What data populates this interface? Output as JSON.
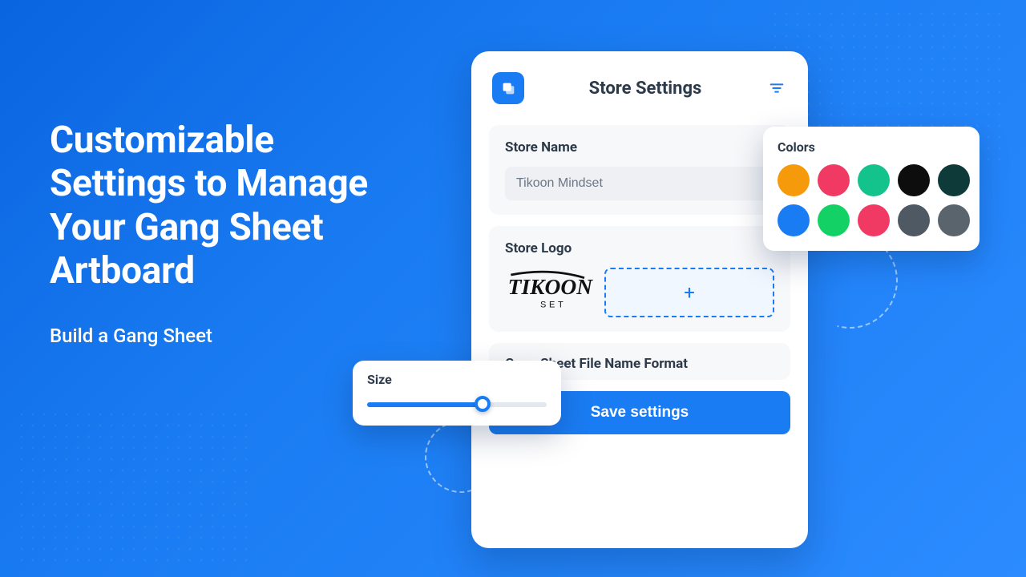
{
  "hero": {
    "headline": "Customizable Settings to Manage Your Gang Sheet Artboard",
    "subline": "Build a Gang Sheet"
  },
  "panel": {
    "title": "Store Settings",
    "store_name_label": "Store Name",
    "store_name_value": "Tikoon Mindset",
    "store_logo_label": "Store Logo",
    "upload_plus": "+",
    "filename_label": "Gang Sheet File Name Format",
    "save_label": "Save settings"
  },
  "colors": {
    "label": "Colors",
    "swatches": [
      "#f59b0b",
      "#f03a63",
      "#14c28b",
      "#0d0d0d",
      "#0e3a3a",
      "#1a7cf2",
      "#14d166",
      "#f03a63",
      "#4f5963",
      "#5a646d"
    ]
  },
  "size": {
    "label": "Size",
    "percent": 62
  }
}
